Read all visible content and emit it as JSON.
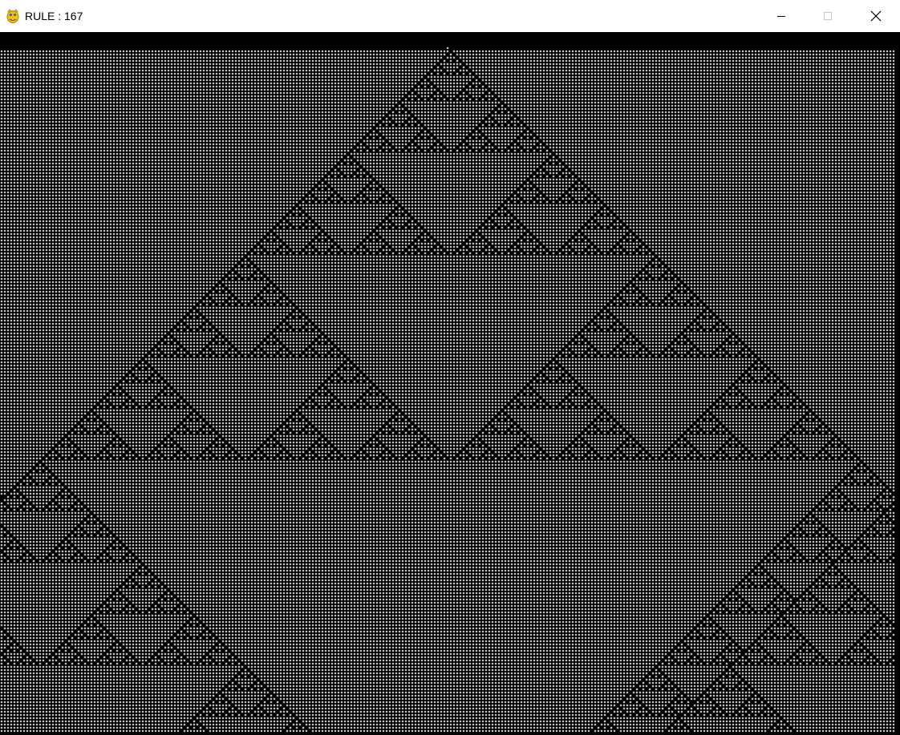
{
  "window": {
    "title": "RULE : 167",
    "icon": "pygame-snake-icon",
    "controls": {
      "minimize_icon": "minimize-icon",
      "maximize_icon": "maximize-icon",
      "close_icon": "close-icon"
    }
  },
  "automaton": {
    "rule": 167,
    "cell_on_color": "#ffffff",
    "cell_off_color": "#000000"
  }
}
